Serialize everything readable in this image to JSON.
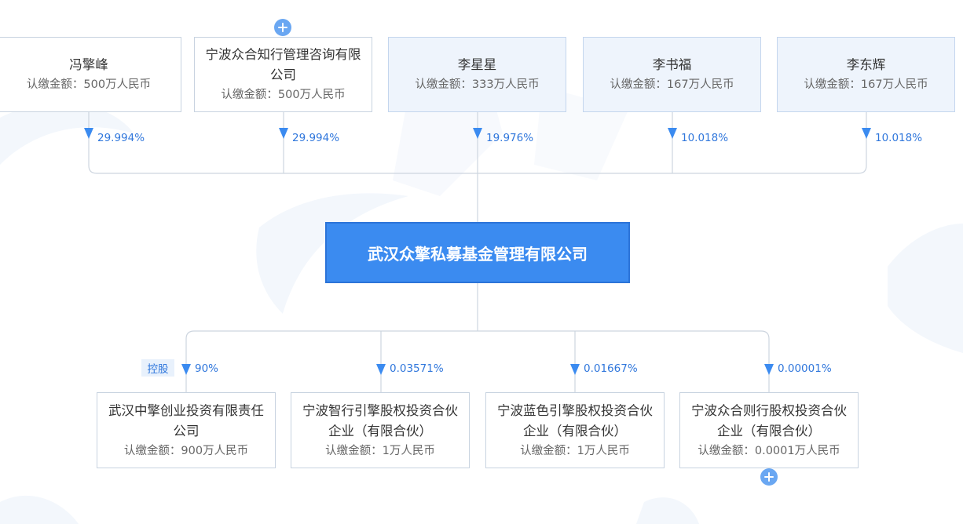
{
  "shareholders": [
    {
      "name": "冯擎峰",
      "amount": "认缴金额：500万人民币",
      "percent": "29.994%"
    },
    {
      "name": "宁波众合知行管理咨询有限公司",
      "amount": "认缴金额：500万人民币",
      "percent": "29.994%"
    },
    {
      "name": "李星星",
      "amount": "认缴金额：333万人民币",
      "percent": "19.976%"
    },
    {
      "name": "李书福",
      "amount": "认缴金额：167万人民币",
      "percent": "10.018%"
    },
    {
      "name": "李东辉",
      "amount": "认缴金额：167万人民币",
      "percent": "10.018%"
    }
  ],
  "company": {
    "name": "武汉众擎私募基金管理有限公司"
  },
  "investments": [
    {
      "name": "武汉中擎创业投资有限责任公司",
      "amount": "认缴金额：900万人民币",
      "percent": "90%",
      "tag": "控股"
    },
    {
      "name": "宁波智行引擎股权投资合伙企业（有限合伙）",
      "amount": "认缴金额：1万人民币",
      "percent": "0.03571%"
    },
    {
      "name": "宁波蓝色引擎股权投资合伙企业（有限合伙）",
      "amount": "认缴金额：1万人民币",
      "percent": "0.01667%"
    },
    {
      "name": "宁波众合则行股权投资合伙企业（有限合伙）",
      "amount": "认缴金额：0.0001万人民币",
      "percent": "0.00001%"
    }
  ],
  "colors": {
    "accent": "#3b8bf0",
    "line": "#cdd5df",
    "percent_text": "#3077dc"
  },
  "icons": {
    "expand": "plus-circle-icon",
    "arrow": "arrow-down-icon"
  }
}
